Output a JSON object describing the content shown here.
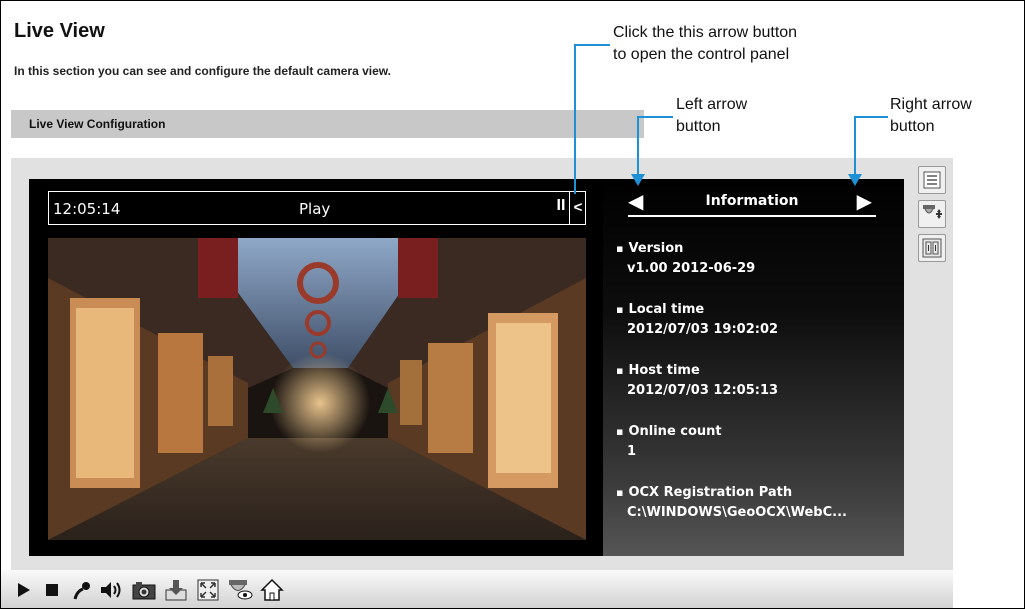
{
  "page": {
    "title": "Live View",
    "description": "In this section you can see and configure the default camera view."
  },
  "config_section": {
    "label": "Live View Configuration"
  },
  "annotations": {
    "open_panel": {
      "line1": "Click the this arrow button",
      "line2": "to open the control panel"
    },
    "left_arrow": {
      "line1": "Left arrow",
      "line2": "button"
    },
    "right_arrow": {
      "line1": "Right arrow",
      "line2": "button"
    }
  },
  "player": {
    "time": "12:05:14",
    "state": "Play",
    "pause_label": "II",
    "open_panel_label": "<"
  },
  "info_panel": {
    "title": "Information",
    "items": [
      {
        "key": "Version",
        "value": "v1.00  2012-06-29"
      },
      {
        "key": "Local time",
        "value": "2012/07/03 19:02:02"
      },
      {
        "key": "Host time",
        "value": "2012/07/03 12:05:13"
      },
      {
        "key": "Online count",
        "value": "1"
      },
      {
        "key": "OCX Registration Path",
        "value": "C:\\WINDOWS\\GeoOCX\\WebC..."
      }
    ]
  },
  "side_buttons": [
    "list-icon",
    "ptz-camera-icon",
    "io-control-icon"
  ],
  "toolbar": [
    "play-icon",
    "stop-icon",
    "microphone-icon",
    "speaker-icon",
    "snapshot-icon",
    "download-icon",
    "fullscreen-icon",
    "camera-view-icon",
    "home-icon"
  ],
  "colors": {
    "annotation_line": "#1e90d6",
    "config_bar": "#c8c8c8",
    "viewer_bg": "#000000"
  }
}
